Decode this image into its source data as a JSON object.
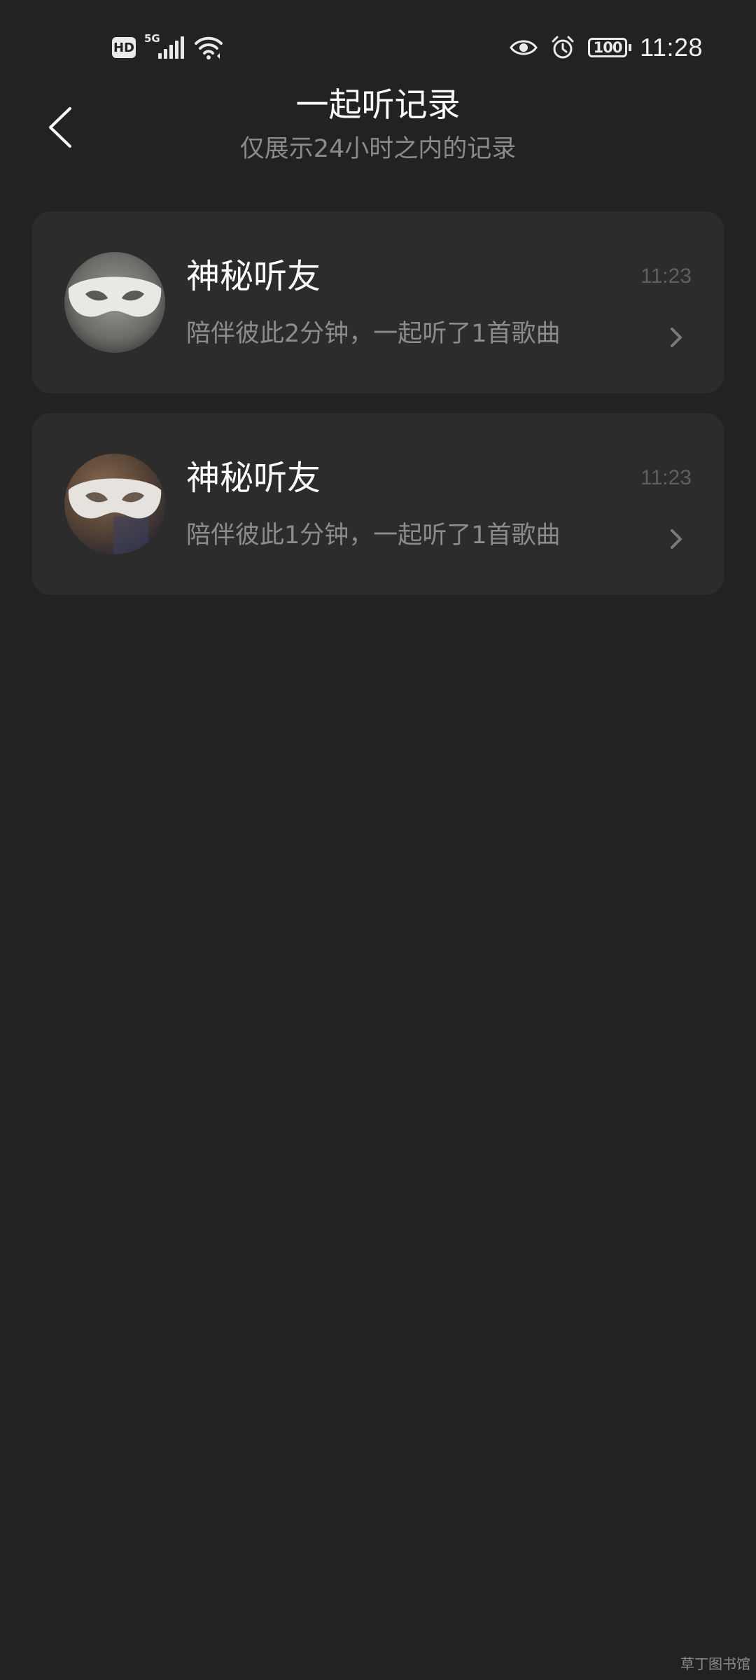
{
  "status_bar": {
    "network_badge": "HD",
    "signal_type": "5G",
    "battery_level": "100",
    "time": "11:28"
  },
  "header": {
    "title": "一起听记录",
    "subtitle": "仅展示24小时之内的记录"
  },
  "records": [
    {
      "name": "神秘听友",
      "description": "陪伴彼此2分钟，一起听了1首歌曲",
      "time": "11:23"
    },
    {
      "name": "神秘听友",
      "description": "陪伴彼此1分钟，一起听了1首歌曲",
      "time": "11:23"
    }
  ],
  "watermark": "草丁图书馆"
}
